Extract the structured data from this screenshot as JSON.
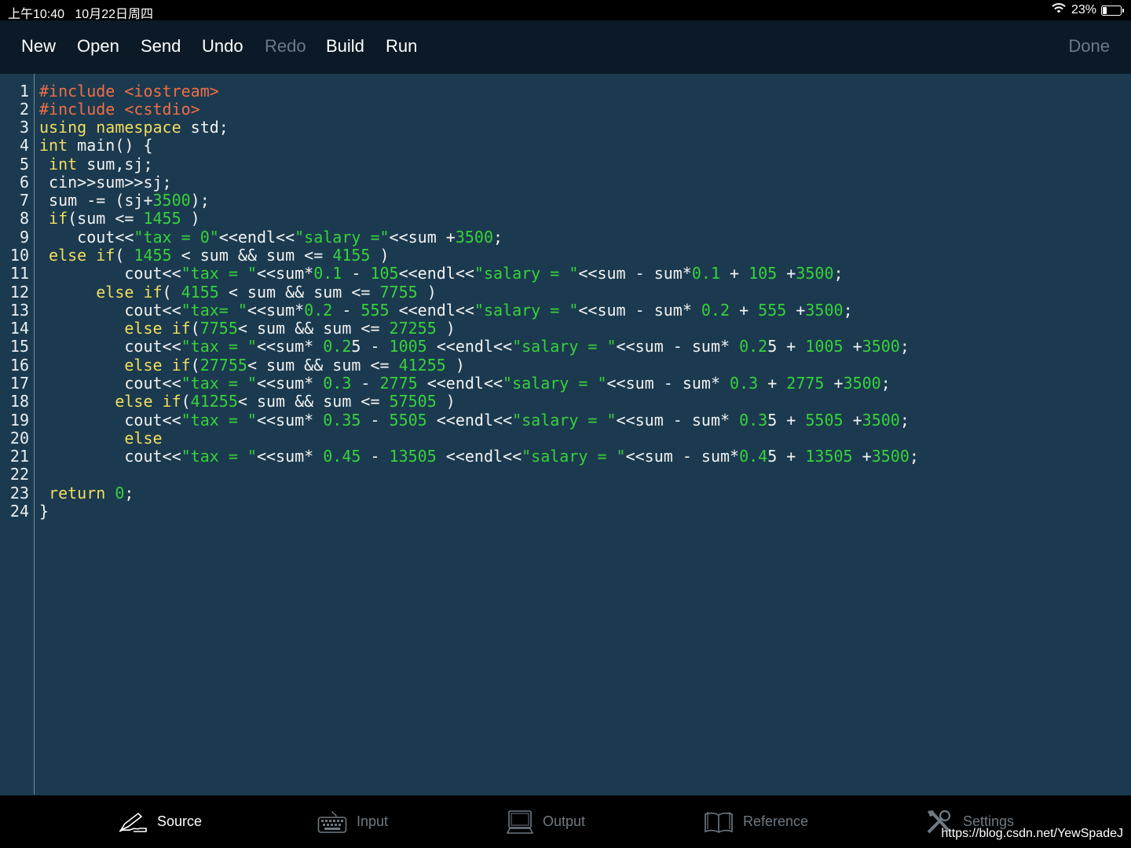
{
  "status": {
    "time": "上午10:40",
    "date": "10月22日周四",
    "battery": "23%",
    "battery_level": 0.23,
    "icons": [
      "wifi-icon",
      "battery-icon"
    ]
  },
  "toolbar": {
    "new_label": "New",
    "open_label": "Open",
    "send_label": "Send",
    "undo_label": "Undo",
    "redo_label": "Redo",
    "build_label": "Build",
    "run_label": "Run",
    "done_label": "Done"
  },
  "editor": {
    "line_numbers": [
      "1",
      "2",
      "3",
      "4",
      "5",
      "6",
      "7",
      "8",
      "9",
      "10",
      "11",
      "12",
      "13",
      "14",
      "15",
      "16",
      "17",
      "18",
      "19",
      "20",
      "21",
      "22",
      "23",
      "24"
    ],
    "lines": [
      [
        [
          "pre",
          "#include <iostream>"
        ]
      ],
      [
        [
          "pre",
          "#include <cstdio>"
        ]
      ],
      [
        [
          "kw",
          "using namespace"
        ],
        [
          "txt",
          " std;"
        ]
      ],
      [
        [
          "kw",
          "int"
        ],
        [
          "txt",
          " main() {"
        ]
      ],
      [
        [
          "txt",
          " "
        ],
        [
          "kw",
          "int"
        ],
        [
          "txt",
          " sum,sj;"
        ]
      ],
      [
        [
          "txt",
          " cin>>sum>>sj;"
        ]
      ],
      [
        [
          "txt",
          " sum -= (sj+"
        ],
        [
          "num",
          "3500"
        ],
        [
          "txt",
          ");"
        ]
      ],
      [
        [
          "txt",
          " "
        ],
        [
          "kw",
          "if"
        ],
        [
          "txt",
          "(sum <= "
        ],
        [
          "num",
          "1455"
        ],
        [
          "txt",
          " )"
        ]
      ],
      [
        [
          "txt",
          "    cout<<"
        ],
        [
          "str",
          "\"tax = 0\""
        ],
        [
          "txt",
          "<<endl<<"
        ],
        [
          "str",
          "\"salary =\""
        ],
        [
          "txt",
          "<<sum +"
        ],
        [
          "num",
          "3500"
        ],
        [
          "txt",
          ";"
        ]
      ],
      [
        [
          "txt",
          " "
        ],
        [
          "kw",
          "else if"
        ],
        [
          "txt",
          "( "
        ],
        [
          "num",
          "1455"
        ],
        [
          "txt",
          " < sum && sum <= "
        ],
        [
          "num",
          "4155"
        ],
        [
          "txt",
          " )"
        ]
      ],
      [
        [
          "txt",
          "         cout<<"
        ],
        [
          "str",
          "\"tax = \""
        ],
        [
          "txt",
          "<<sum*"
        ],
        [
          "num",
          "0.1"
        ],
        [
          "txt",
          " - "
        ],
        [
          "num",
          "105"
        ],
        [
          "txt",
          "<<endl<<"
        ],
        [
          "str",
          "\"salary = \""
        ],
        [
          "txt",
          "<<sum - sum*"
        ],
        [
          "num",
          "0.1"
        ],
        [
          "txt",
          " + "
        ],
        [
          "num",
          "105"
        ],
        [
          "txt",
          " +"
        ],
        [
          "num",
          "3500"
        ],
        [
          "txt",
          ";"
        ]
      ],
      [
        [
          "txt",
          "      "
        ],
        [
          "kw",
          "else if"
        ],
        [
          "txt",
          "( "
        ],
        [
          "num",
          "4155"
        ],
        [
          "txt",
          " < sum && sum <= "
        ],
        [
          "num",
          "7755"
        ],
        [
          "txt",
          " )"
        ]
      ],
      [
        [
          "txt",
          "         cout<<"
        ],
        [
          "str",
          "\"tax= \""
        ],
        [
          "txt",
          "<<sum*"
        ],
        [
          "num",
          "0.2"
        ],
        [
          "txt",
          " - "
        ],
        [
          "num",
          "555"
        ],
        [
          "txt",
          " <<endl<<"
        ],
        [
          "str",
          "\"salary = \""
        ],
        [
          "txt",
          "<<sum - sum* "
        ],
        [
          "num",
          "0.2"
        ],
        [
          "txt",
          " + "
        ],
        [
          "num",
          "555"
        ],
        [
          "txt",
          " +"
        ],
        [
          "num",
          "3500"
        ],
        [
          "txt",
          ";"
        ]
      ],
      [
        [
          "txt",
          "         "
        ],
        [
          "kw",
          "else if"
        ],
        [
          "txt",
          "("
        ],
        [
          "num",
          "7755"
        ],
        [
          "txt",
          "< sum && sum <= "
        ],
        [
          "num",
          "27255"
        ],
        [
          "txt",
          " )"
        ]
      ],
      [
        [
          "txt",
          "         cout<<"
        ],
        [
          "str",
          "\"tax = \""
        ],
        [
          "txt",
          "<<sum* "
        ],
        [
          "num",
          "0.2"
        ],
        [
          "txt",
          "5 - "
        ],
        [
          "num",
          "1005"
        ],
        [
          "txt",
          " <<endl<<"
        ],
        [
          "str",
          "\"salary = \""
        ],
        [
          "txt",
          "<<sum - sum* "
        ],
        [
          "num",
          "0.2"
        ],
        [
          "txt",
          "5 + "
        ],
        [
          "num",
          "1005"
        ],
        [
          "txt",
          " +"
        ],
        [
          "num",
          "3500"
        ],
        [
          "txt",
          ";"
        ]
      ],
      [
        [
          "txt",
          "         "
        ],
        [
          "kw",
          "else if"
        ],
        [
          "txt",
          "("
        ],
        [
          "num",
          "27755"
        ],
        [
          "txt",
          "< sum && sum <= "
        ],
        [
          "num",
          "41255"
        ],
        [
          "txt",
          " )"
        ]
      ],
      [
        [
          "txt",
          "         cout<<"
        ],
        [
          "str",
          "\"tax = \""
        ],
        [
          "txt",
          "<<sum* "
        ],
        [
          "num",
          "0.3"
        ],
        [
          "txt",
          " - "
        ],
        [
          "num",
          "2775"
        ],
        [
          "txt",
          " <<endl<<"
        ],
        [
          "str",
          "\"salary = \""
        ],
        [
          "txt",
          "<<sum - sum* "
        ],
        [
          "num",
          "0.3"
        ],
        [
          "txt",
          " + "
        ],
        [
          "num",
          "2775"
        ],
        [
          "txt",
          " +"
        ],
        [
          "num",
          "3500"
        ],
        [
          "txt",
          ";"
        ]
      ],
      [
        [
          "txt",
          "        "
        ],
        [
          "kw",
          "else if"
        ],
        [
          "txt",
          "("
        ],
        [
          "num",
          "41255"
        ],
        [
          "txt",
          "< sum && sum <= "
        ],
        [
          "num",
          "57505"
        ],
        [
          "txt",
          " )"
        ]
      ],
      [
        [
          "txt",
          "         cout<<"
        ],
        [
          "str",
          "\"tax = \""
        ],
        [
          "txt",
          "<<sum* "
        ],
        [
          "num",
          "0.35"
        ],
        [
          "txt",
          " - "
        ],
        [
          "num",
          "5505"
        ],
        [
          "txt",
          " <<endl<<"
        ],
        [
          "str",
          "\"salary = \""
        ],
        [
          "txt",
          "<<sum - sum* "
        ],
        [
          "num",
          "0.3"
        ],
        [
          "txt",
          "5 + "
        ],
        [
          "num",
          "5505"
        ],
        [
          "txt",
          " +"
        ],
        [
          "num",
          "3500"
        ],
        [
          "txt",
          ";"
        ]
      ],
      [
        [
          "txt",
          "         "
        ],
        [
          "kw",
          "else"
        ]
      ],
      [
        [
          "txt",
          "         cout<<"
        ],
        [
          "str",
          "\"tax = \""
        ],
        [
          "txt",
          "<<sum* "
        ],
        [
          "num",
          "0.45"
        ],
        [
          "txt",
          " - "
        ],
        [
          "num",
          "13505"
        ],
        [
          "txt",
          " <<endl<<"
        ],
        [
          "str",
          "\"salary = \""
        ],
        [
          "txt",
          "<<sum - sum*"
        ],
        [
          "num",
          "0.4"
        ],
        [
          "txt",
          "5 + "
        ],
        [
          "num",
          "13505"
        ],
        [
          "txt",
          " +"
        ],
        [
          "num",
          "3500"
        ],
        [
          "txt",
          ";"
        ]
      ],
      [],
      [
        [
          "txt",
          " "
        ],
        [
          "kw",
          "return"
        ],
        [
          "txt",
          " "
        ],
        [
          "num",
          "0"
        ],
        [
          "txt",
          ";"
        ]
      ],
      [
        [
          "txt",
          "}"
        ]
      ]
    ]
  },
  "tabs": [
    {
      "label": "Source",
      "icon": "pen-icon",
      "active": true
    },
    {
      "label": "Input",
      "icon": "keyboard-icon",
      "active": false
    },
    {
      "label": "Output",
      "icon": "monitor-icon",
      "active": false
    },
    {
      "label": "Reference",
      "icon": "book-icon",
      "active": false
    },
    {
      "label": "Settings",
      "icon": "tools-icon",
      "active": false
    }
  ],
  "watermark": "https://blog.csdn.net/YewSpadeJ",
  "colors": {
    "background": "#1b3a4f",
    "toolbar": "#0b1a26",
    "preprocessor": "#ef6e47",
    "keyword": "#f1dd5e",
    "number_string": "#38d13b",
    "text": "#f2f2f2",
    "disabled": "#6b7a86"
  }
}
